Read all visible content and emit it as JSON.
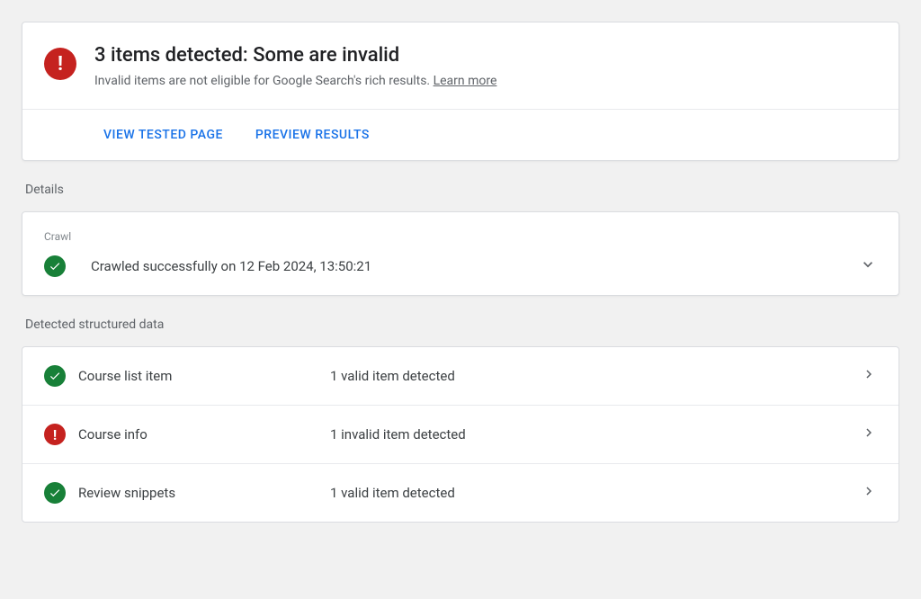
{
  "summary": {
    "title": "3 items detected: Some are invalid",
    "description": "Invalid items are not eligible for Google Search's rich results. ",
    "learn_more": "Learn more",
    "actions": {
      "view_tested": "VIEW TESTED PAGE",
      "preview": "PREVIEW RESULTS"
    }
  },
  "details": {
    "label": "Details",
    "crawl_section_label": "Crawl",
    "crawl_status": "Crawled successfully on 12 Feb 2024, 13:50:21"
  },
  "structured_data": {
    "label": "Detected structured data",
    "items": [
      {
        "name": "Course list item",
        "status": "1 valid item detected",
        "state": "valid"
      },
      {
        "name": "Course info",
        "status": "1 invalid item detected",
        "state": "invalid"
      },
      {
        "name": "Review snippets",
        "status": "1 valid item detected",
        "state": "valid"
      }
    ]
  }
}
